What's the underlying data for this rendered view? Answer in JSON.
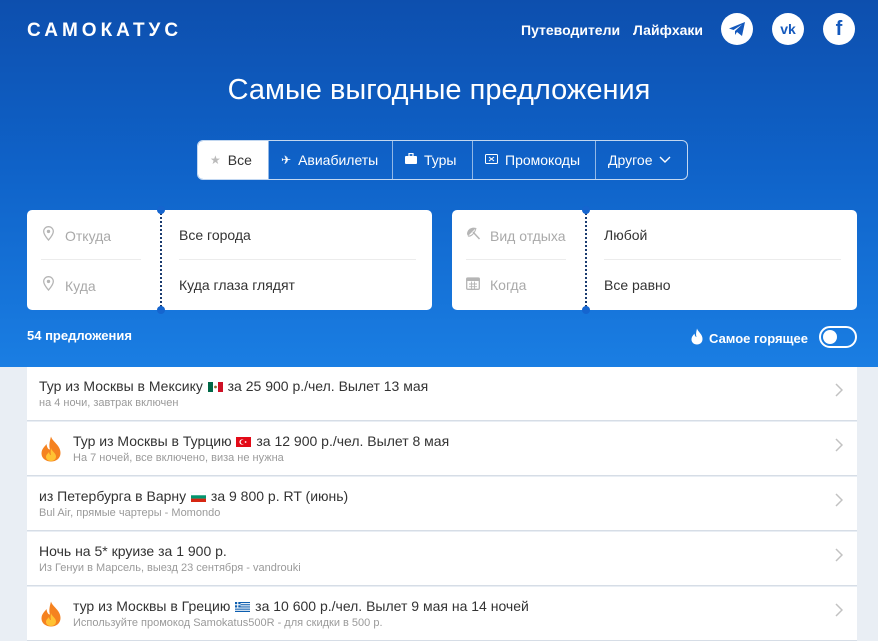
{
  "brand": {
    "logo": "САМОКАТУС"
  },
  "nav": [
    {
      "label": "Путеводители"
    },
    {
      "label": "Лайфхаки"
    }
  ],
  "social": [
    {
      "icon": "telegram-icon"
    },
    {
      "icon": "vk-icon",
      "text": "vk"
    },
    {
      "icon": "facebook-icon",
      "text": "f"
    }
  ],
  "heading": "Самые выгодные предложения",
  "tabs": [
    {
      "label": "Все",
      "icon": "star-icon",
      "active": true
    },
    {
      "label": "Авиабилеты",
      "icon": "plane-icon"
    },
    {
      "label": "Туры",
      "icon": "suitcase-icon"
    },
    {
      "label": "Промокоды",
      "icon": "ticket-icon"
    },
    {
      "label": "Другое",
      "icon": "chevron-down-icon"
    }
  ],
  "search_left": {
    "from_label": "Откуда",
    "from_value": "Все города",
    "to_label": "Куда",
    "to_value": "Куда глаза глядят"
  },
  "search_right": {
    "type_label": "Вид отдыха",
    "type_value": "Любой",
    "when_label": "Когда",
    "when_value": "Все равно"
  },
  "count": "54 предложения",
  "hot_label": "Самое горящее",
  "hot_toggle": false,
  "colors": {
    "hero_top": "#0d4fae",
    "hero_bottom": "#1a7ee3",
    "fire": "#f58220"
  },
  "offers": [
    {
      "pre": "Тур из Москвы в Мексику",
      "flag": "mexico",
      "post": "за 25 900 р./чел. Вылет 13 мая",
      "sub": "на 4 ночи, завтрак включен",
      "fire": false
    },
    {
      "pre": "Тур из Москвы в Турцию",
      "flag": "turkey",
      "post": "за 12 900 р./чел. Вылет 8 мая",
      "sub": "На 7 ночей, все включено, виза не нужна",
      "fire": true
    },
    {
      "pre": "из Петербурга в Варну",
      "flag": "bulgaria",
      "post": "за 9 800 р. RT (июнь)",
      "sub": "Bul Air, прямые чартеры - Momondo",
      "fire": false
    },
    {
      "pre": "Ночь на 5* круизе за 1 900 р.",
      "flag": "",
      "post": "",
      "sub": "Из Генуи в Марсель, выезд 23 сентября - vandrouki",
      "fire": false
    },
    {
      "pre": "тур из Москвы в Грецию",
      "flag": "greece",
      "post": "за 10 600 р./чел. Вылет 9 мая на 14 ночей",
      "sub": "Используйте промокод Samokatus500R - для скидки в 500 р.",
      "fire": true
    }
  ]
}
